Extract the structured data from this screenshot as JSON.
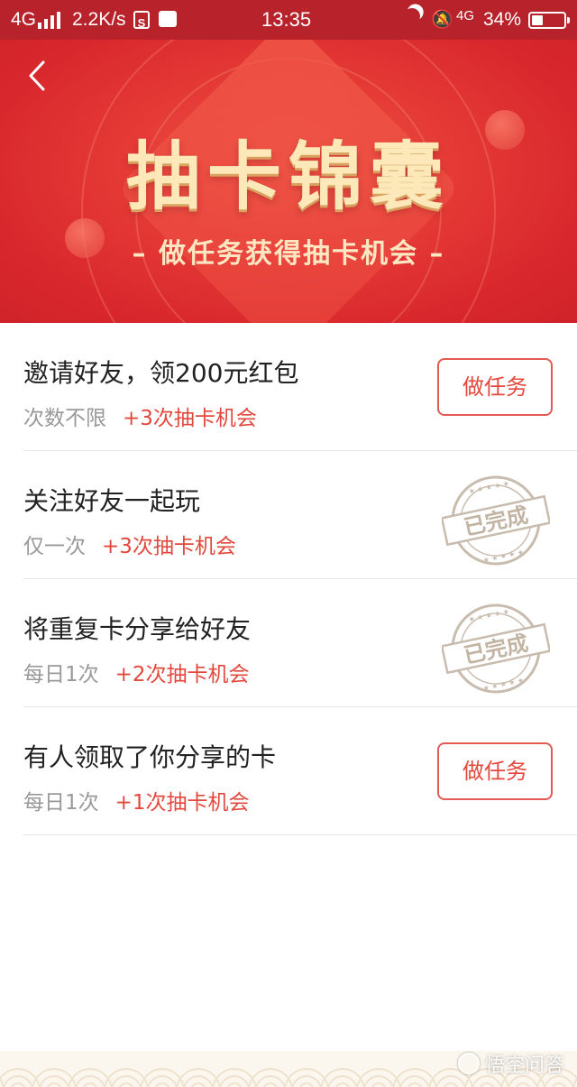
{
  "status_bar": {
    "network": "4G",
    "speed": "2.2K/s",
    "s_icon_letter": "S",
    "time": "13:35",
    "network_right": "4G",
    "battery_text": "34%",
    "battery_level": 0.34
  },
  "banner": {
    "title": "抽卡锦囊",
    "subtitle": "– 做任务获得抽卡机会 –"
  },
  "tasks": [
    {
      "title": "邀请好友，领200元红包",
      "frequency": "次数不限",
      "reward": "+3次抽卡机会",
      "action": "做任务",
      "completed": false
    },
    {
      "title": "关注好友一起玩",
      "frequency": "仅一次",
      "reward": "+3次抽卡机会",
      "stamp": "已完成",
      "completed": true
    },
    {
      "title": "将重复卡分享给好友",
      "frequency": "每日1次",
      "reward": "+2次抽卡机会",
      "stamp": "已完成",
      "completed": true
    },
    {
      "title": "有人领取了你分享的卡",
      "frequency": "每日1次",
      "reward": "+1次抽卡机会",
      "action": "做任务",
      "completed": false
    }
  ],
  "watermark": "悟空问答",
  "colors": {
    "status_bar": "#b8222a",
    "banner_red": "#e53a36",
    "title_gold": "#fce8b8",
    "reward_red": "#e2483d",
    "stamp_gray": "#c8bcae"
  }
}
